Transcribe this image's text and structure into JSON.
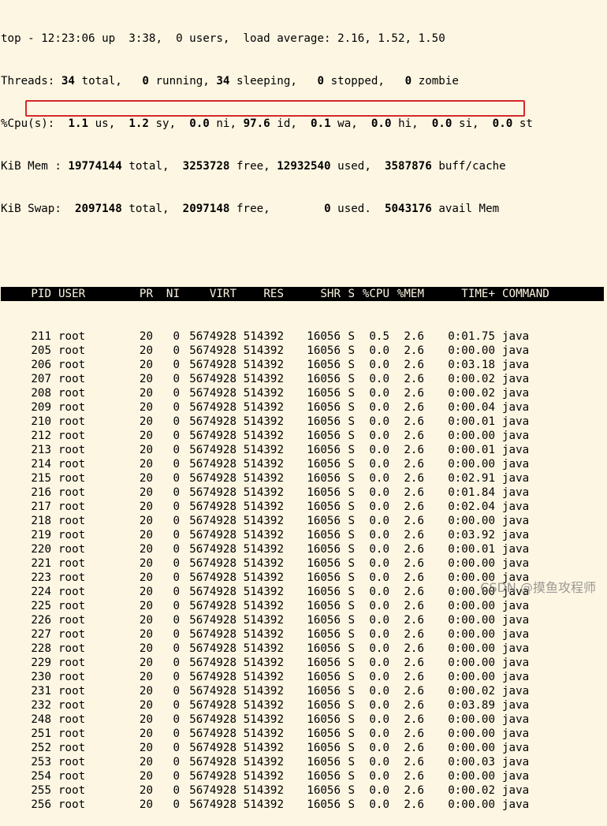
{
  "summary": {
    "line1": "top - 12:23:06 up  3:38,  0 users,  load average: 2.16, 1.52, 1.50",
    "threads": {
      "label": "Threads:",
      "total": "34",
      "total_lbl": "total,",
      "running": "0",
      "running_lbl": "running,",
      "sleeping": "34",
      "sleeping_lbl": "sleeping,",
      "stopped": "0",
      "stopped_lbl": "stopped,",
      "zombie": "0",
      "zombie_lbl": "zombie"
    },
    "cpu": {
      "label": "%Cpu(s):",
      "us": "1.1",
      "us_lbl": "us,",
      "sy": "1.2",
      "sy_lbl": "sy,",
      "ni": "0.0",
      "ni_lbl": "ni,",
      "id": "97.6",
      "id_lbl": "id,",
      "wa": "0.1",
      "wa_lbl": "wa,",
      "hi": "0.0",
      "hi_lbl": "hi,",
      "si": "0.0",
      "si_lbl": "si,",
      "st": "0.0",
      "st_lbl": "st"
    },
    "mem": {
      "label": "KiB Mem :",
      "total": "19774144",
      "total_lbl": "total,",
      "free": "3253728",
      "free_lbl": "free,",
      "used": "12932540",
      "used_lbl": "used,",
      "buff": "3587876",
      "buff_lbl": "buff/cache"
    },
    "swap": {
      "label": "KiB Swap:",
      "total": "2097148",
      "total_lbl": "total,",
      "free": "2097148",
      "free_lbl": "free,",
      "used": "0",
      "used_lbl": "used.",
      "avail": "5043176",
      "avail_lbl": "avail Mem"
    }
  },
  "columns": [
    "PID",
    "USER",
    "PR",
    "NI",
    "VIRT",
    "RES",
    "SHR",
    "S",
    "%CPU",
    "%MEM",
    "TIME+",
    "COMMAND"
  ],
  "processes": [
    {
      "pid": "211",
      "user": "root",
      "pr": "20",
      "ni": "0",
      "virt": "5674928",
      "res": "514392",
      "shr": "16056",
      "s": "S",
      "cpu": "0.5",
      "mem": "2.6",
      "time": "0:01.75",
      "cmd": "java"
    },
    {
      "pid": "205",
      "user": "root",
      "pr": "20",
      "ni": "0",
      "virt": "5674928",
      "res": "514392",
      "shr": "16056",
      "s": "S",
      "cpu": "0.0",
      "mem": "2.6",
      "time": "0:00.00",
      "cmd": "java"
    },
    {
      "pid": "206",
      "user": "root",
      "pr": "20",
      "ni": "0",
      "virt": "5674928",
      "res": "514392",
      "shr": "16056",
      "s": "S",
      "cpu": "0.0",
      "mem": "2.6",
      "time": "0:03.18",
      "cmd": "java"
    },
    {
      "pid": "207",
      "user": "root",
      "pr": "20",
      "ni": "0",
      "virt": "5674928",
      "res": "514392",
      "shr": "16056",
      "s": "S",
      "cpu": "0.0",
      "mem": "2.6",
      "time": "0:00.02",
      "cmd": "java"
    },
    {
      "pid": "208",
      "user": "root",
      "pr": "20",
      "ni": "0",
      "virt": "5674928",
      "res": "514392",
      "shr": "16056",
      "s": "S",
      "cpu": "0.0",
      "mem": "2.6",
      "time": "0:00.02",
      "cmd": "java"
    },
    {
      "pid": "209",
      "user": "root",
      "pr": "20",
      "ni": "0",
      "virt": "5674928",
      "res": "514392",
      "shr": "16056",
      "s": "S",
      "cpu": "0.0",
      "mem": "2.6",
      "time": "0:00.04",
      "cmd": "java"
    },
    {
      "pid": "210",
      "user": "root",
      "pr": "20",
      "ni": "0",
      "virt": "5674928",
      "res": "514392",
      "shr": "16056",
      "s": "S",
      "cpu": "0.0",
      "mem": "2.6",
      "time": "0:00.01",
      "cmd": "java"
    },
    {
      "pid": "212",
      "user": "root",
      "pr": "20",
      "ni": "0",
      "virt": "5674928",
      "res": "514392",
      "shr": "16056",
      "s": "S",
      "cpu": "0.0",
      "mem": "2.6",
      "time": "0:00.00",
      "cmd": "java"
    },
    {
      "pid": "213",
      "user": "root",
      "pr": "20",
      "ni": "0",
      "virt": "5674928",
      "res": "514392",
      "shr": "16056",
      "s": "S",
      "cpu": "0.0",
      "mem": "2.6",
      "time": "0:00.01",
      "cmd": "java"
    },
    {
      "pid": "214",
      "user": "root",
      "pr": "20",
      "ni": "0",
      "virt": "5674928",
      "res": "514392",
      "shr": "16056",
      "s": "S",
      "cpu": "0.0",
      "mem": "2.6",
      "time": "0:00.00",
      "cmd": "java"
    },
    {
      "pid": "215",
      "user": "root",
      "pr": "20",
      "ni": "0",
      "virt": "5674928",
      "res": "514392",
      "shr": "16056",
      "s": "S",
      "cpu": "0.0",
      "mem": "2.6",
      "time": "0:02.91",
      "cmd": "java"
    },
    {
      "pid": "216",
      "user": "root",
      "pr": "20",
      "ni": "0",
      "virt": "5674928",
      "res": "514392",
      "shr": "16056",
      "s": "S",
      "cpu": "0.0",
      "mem": "2.6",
      "time": "0:01.84",
      "cmd": "java"
    },
    {
      "pid": "217",
      "user": "root",
      "pr": "20",
      "ni": "0",
      "virt": "5674928",
      "res": "514392",
      "shr": "16056",
      "s": "S",
      "cpu": "0.0",
      "mem": "2.6",
      "time": "0:02.04",
      "cmd": "java"
    },
    {
      "pid": "218",
      "user": "root",
      "pr": "20",
      "ni": "0",
      "virt": "5674928",
      "res": "514392",
      "shr": "16056",
      "s": "S",
      "cpu": "0.0",
      "mem": "2.6",
      "time": "0:00.00",
      "cmd": "java"
    },
    {
      "pid": "219",
      "user": "root",
      "pr": "20",
      "ni": "0",
      "virt": "5674928",
      "res": "514392",
      "shr": "16056",
      "s": "S",
      "cpu": "0.0",
      "mem": "2.6",
      "time": "0:03.92",
      "cmd": "java"
    },
    {
      "pid": "220",
      "user": "root",
      "pr": "20",
      "ni": "0",
      "virt": "5674928",
      "res": "514392",
      "shr": "16056",
      "s": "S",
      "cpu": "0.0",
      "mem": "2.6",
      "time": "0:00.01",
      "cmd": "java"
    },
    {
      "pid": "221",
      "user": "root",
      "pr": "20",
      "ni": "0",
      "virt": "5674928",
      "res": "514392",
      "shr": "16056",
      "s": "S",
      "cpu": "0.0",
      "mem": "2.6",
      "time": "0:00.00",
      "cmd": "java"
    },
    {
      "pid": "223",
      "user": "root",
      "pr": "20",
      "ni": "0",
      "virt": "5674928",
      "res": "514392",
      "shr": "16056",
      "s": "S",
      "cpu": "0.0",
      "mem": "2.6",
      "time": "0:00.00",
      "cmd": "java"
    },
    {
      "pid": "224",
      "user": "root",
      "pr": "20",
      "ni": "0",
      "virt": "5674928",
      "res": "514392",
      "shr": "16056",
      "s": "S",
      "cpu": "0.0",
      "mem": "2.6",
      "time": "0:00.00",
      "cmd": "java"
    },
    {
      "pid": "225",
      "user": "root",
      "pr": "20",
      "ni": "0",
      "virt": "5674928",
      "res": "514392",
      "shr": "16056",
      "s": "S",
      "cpu": "0.0",
      "mem": "2.6",
      "time": "0:00.00",
      "cmd": "java"
    },
    {
      "pid": "226",
      "user": "root",
      "pr": "20",
      "ni": "0",
      "virt": "5674928",
      "res": "514392",
      "shr": "16056",
      "s": "S",
      "cpu": "0.0",
      "mem": "2.6",
      "time": "0:00.00",
      "cmd": "java"
    },
    {
      "pid": "227",
      "user": "root",
      "pr": "20",
      "ni": "0",
      "virt": "5674928",
      "res": "514392",
      "shr": "16056",
      "s": "S",
      "cpu": "0.0",
      "mem": "2.6",
      "time": "0:00.00",
      "cmd": "java"
    },
    {
      "pid": "228",
      "user": "root",
      "pr": "20",
      "ni": "0",
      "virt": "5674928",
      "res": "514392",
      "shr": "16056",
      "s": "S",
      "cpu": "0.0",
      "mem": "2.6",
      "time": "0:00.00",
      "cmd": "java"
    },
    {
      "pid": "229",
      "user": "root",
      "pr": "20",
      "ni": "0",
      "virt": "5674928",
      "res": "514392",
      "shr": "16056",
      "s": "S",
      "cpu": "0.0",
      "mem": "2.6",
      "time": "0:00.00",
      "cmd": "java"
    },
    {
      "pid": "230",
      "user": "root",
      "pr": "20",
      "ni": "0",
      "virt": "5674928",
      "res": "514392",
      "shr": "16056",
      "s": "S",
      "cpu": "0.0",
      "mem": "2.6",
      "time": "0:00.00",
      "cmd": "java"
    },
    {
      "pid": "231",
      "user": "root",
      "pr": "20",
      "ni": "0",
      "virt": "5674928",
      "res": "514392",
      "shr": "16056",
      "s": "S",
      "cpu": "0.0",
      "mem": "2.6",
      "time": "0:00.02",
      "cmd": "java"
    },
    {
      "pid": "232",
      "user": "root",
      "pr": "20",
      "ni": "0",
      "virt": "5674928",
      "res": "514392",
      "shr": "16056",
      "s": "S",
      "cpu": "0.0",
      "mem": "2.6",
      "time": "0:03.89",
      "cmd": "java"
    },
    {
      "pid": "248",
      "user": "root",
      "pr": "20",
      "ni": "0",
      "virt": "5674928",
      "res": "514392",
      "shr": "16056",
      "s": "S",
      "cpu": "0.0",
      "mem": "2.6",
      "time": "0:00.00",
      "cmd": "java"
    },
    {
      "pid": "251",
      "user": "root",
      "pr": "20",
      "ni": "0",
      "virt": "5674928",
      "res": "514392",
      "shr": "16056",
      "s": "S",
      "cpu": "0.0",
      "mem": "2.6",
      "time": "0:00.00",
      "cmd": "java"
    },
    {
      "pid": "252",
      "user": "root",
      "pr": "20",
      "ni": "0",
      "virt": "5674928",
      "res": "514392",
      "shr": "16056",
      "s": "S",
      "cpu": "0.0",
      "mem": "2.6",
      "time": "0:00.00",
      "cmd": "java"
    },
    {
      "pid": "253",
      "user": "root",
      "pr": "20",
      "ni": "0",
      "virt": "5674928",
      "res": "514392",
      "shr": "16056",
      "s": "S",
      "cpu": "0.0",
      "mem": "2.6",
      "time": "0:00.03",
      "cmd": "java"
    },
    {
      "pid": "254",
      "user": "root",
      "pr": "20",
      "ni": "0",
      "virt": "5674928",
      "res": "514392",
      "shr": "16056",
      "s": "S",
      "cpu": "0.0",
      "mem": "2.6",
      "time": "0:00.00",
      "cmd": "java"
    },
    {
      "pid": "255",
      "user": "root",
      "pr": "20",
      "ni": "0",
      "virt": "5674928",
      "res": "514392",
      "shr": "16056",
      "s": "S",
      "cpu": "0.0",
      "mem": "2.6",
      "time": "0:00.02",
      "cmd": "java"
    },
    {
      "pid": "256",
      "user": "root",
      "pr": "20",
      "ni": "0",
      "virt": "5674928",
      "res": "514392",
      "shr": "16056",
      "s": "S",
      "cpu": "0.0",
      "mem": "2.6",
      "time": "0:00.00",
      "cmd": "java"
    }
  ],
  "highlight_color": "#d42a2a",
  "watermark": "CSDN @摸鱼攻程师"
}
